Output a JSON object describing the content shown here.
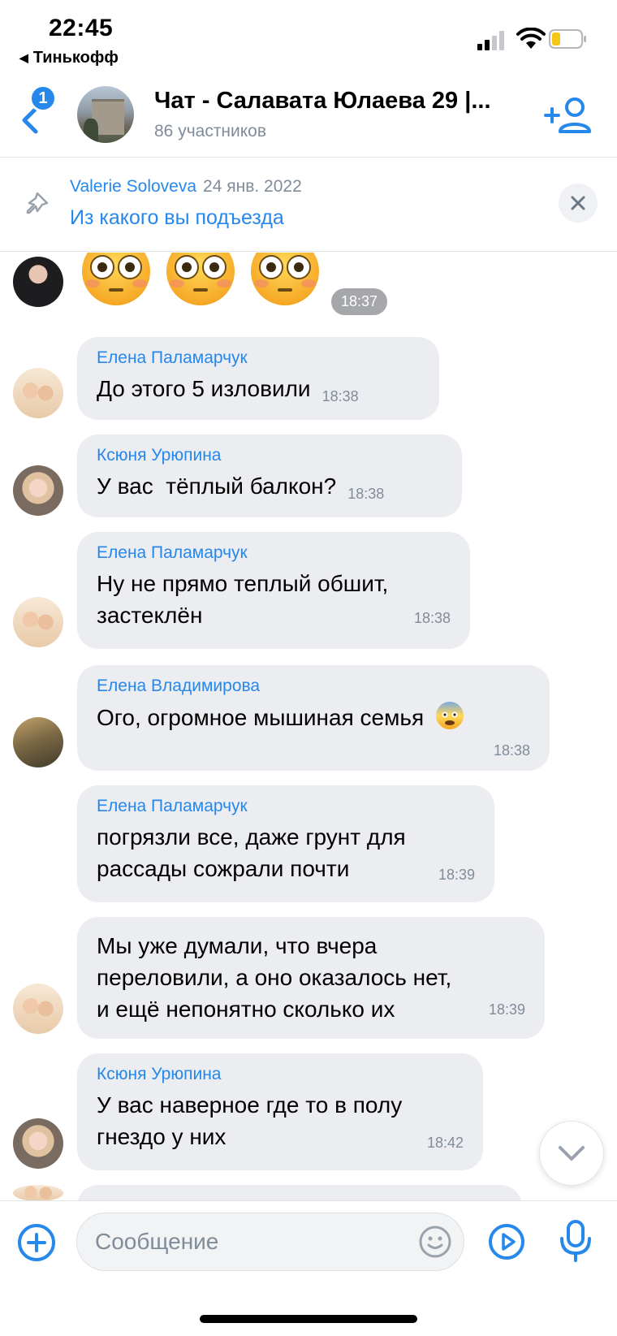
{
  "status_bar": {
    "time": "22:45",
    "back_app": "Тинькофф"
  },
  "header": {
    "unread_badge": "1",
    "title": "Чат - Салавата Юлаева 29 |...",
    "subtitle": "86 участников"
  },
  "pinned": {
    "author": "Valerie Soloveva",
    "date": "24 янв. 2022",
    "text": "Из какого вы подъезда"
  },
  "messages": [
    {
      "sender": "",
      "emoji": [
        "flushed",
        "flushed",
        "flushed"
      ],
      "time": "18:37"
    },
    {
      "sender": "Елена Паламарчук",
      "lines": [
        "До этого 5 изловили"
      ],
      "time": "18:38"
    },
    {
      "sender": "Ксюня Урюпина",
      "lines": [
        "У вас  тёплый балкон?"
      ],
      "time": "18:38"
    },
    {
      "sender": "Елена Паламарчук",
      "lines": [
        "Ну не прямо теплый обшит,",
        "застеклён"
      ],
      "time": "18:38"
    },
    {
      "sender": "Елена Владимирова",
      "lines": [
        "Ого, огромное мышиная семья"
      ],
      "emoji": "fearful",
      "time": "18:38"
    },
    {
      "sender": "Елена Паламарчук",
      "lines": [
        "погрязли все, даже грунт для",
        "рассады сожрали почти"
      ],
      "time": "18:39"
    },
    {
      "sender": "",
      "lines": [
        "Мы уже думали, что вчера",
        "переловили, а оно оказалось нет,",
        "и ещё непонятно сколько их"
      ],
      "time": "18:39"
    },
    {
      "sender": "Ксюня Урюпина",
      "lines": [
        "У вас наверное где то в полу",
        "гнездо у них"
      ],
      "time": "18:42"
    }
  ],
  "composer": {
    "placeholder": "Сообщение"
  },
  "colors": {
    "accent": "#2688eb",
    "bubble": "#ebedf0",
    "secondary_text": "#818c99"
  }
}
